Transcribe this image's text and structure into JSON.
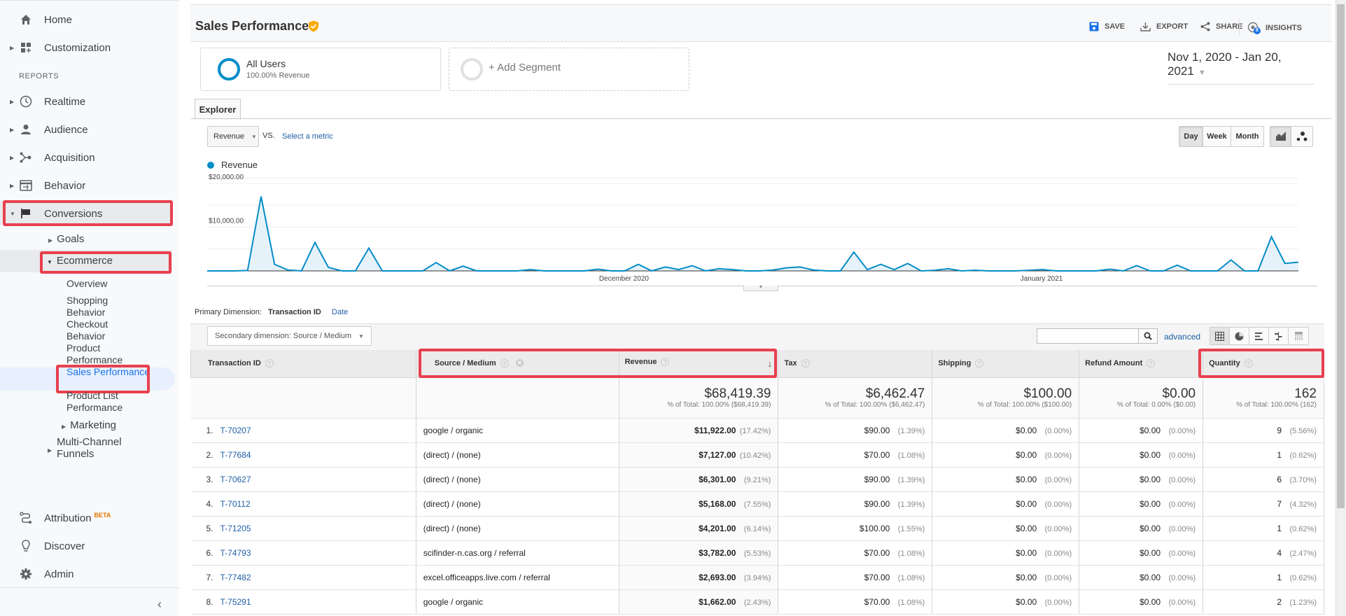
{
  "sidebar": {
    "home": "Home",
    "customization": "Customization",
    "reports_label": "REPORTS",
    "realtime": "Realtime",
    "audience": "Audience",
    "acquisition": "Acquisition",
    "behavior": "Behavior",
    "conversions": "Conversions",
    "goals": "Goals",
    "ecommerce": "Ecommerce",
    "ecommerce_items": [
      "Overview",
      "Shopping Behavior",
      "Checkout Behavior",
      "Product Performance",
      "Sales Performance",
      "Product List Performance"
    ],
    "marketing": "Marketing",
    "multi_channel_1": "Multi-Channel",
    "multi_channel_2": "Funnels",
    "attribution": "Attribution",
    "attribution_badge": "BETA",
    "discover": "Discover",
    "admin": "Admin",
    "collapse_icon": "‹"
  },
  "header": {
    "title": "Sales Performance",
    "save": "SAVE",
    "export": "EXPORT",
    "share": "SHARE",
    "insights": "INSIGHTS",
    "insights_count": "8"
  },
  "segments": {
    "all_users": "All Users",
    "all_users_sub": "100.00% Revenue",
    "add_segment": "+ Add Segment"
  },
  "date_range": "Nov 1, 2020 - Jan 20, 2021",
  "explorer": {
    "tab": "Explorer",
    "metric": "Revenue",
    "vs": "VS.",
    "select_metric": "Select a metric",
    "day": "Day",
    "week": "Week",
    "month": "Month"
  },
  "chart_data": {
    "type": "area",
    "series": [
      {
        "name": "Revenue",
        "color": "#058dc7",
        "values": [
          0,
          0,
          0,
          100,
          17000,
          1500,
          200,
          0,
          6500,
          800,
          0,
          0,
          5200,
          0,
          0,
          0,
          0,
          1900,
          0,
          1100,
          0,
          0,
          0,
          0,
          300,
          0,
          0,
          0,
          0,
          400,
          0,
          0,
          1500,
          0,
          900,
          300,
          1200,
          0,
          500,
          300,
          0,
          0,
          200,
          700,
          900,
          200,
          0,
          0,
          4300,
          300,
          1500,
          300,
          1700,
          0,
          150,
          500,
          0,
          150,
          0,
          0,
          0,
          150,
          300,
          0,
          0,
          0,
          0,
          400,
          0,
          1200,
          0,
          0,
          1300,
          0,
          0,
          0,
          2500,
          0,
          0,
          7800,
          1700,
          2000
        ]
      }
    ],
    "x_start": "2020-11-01",
    "x_end": "2021-01-20",
    "x_tick_labels": [
      "December 2020",
      "January 2021"
    ],
    "y_tick_labels": [
      "$10,000.00",
      "$20,000.00"
    ],
    "ylim": [
      0,
      20000
    ],
    "legend": "top-left",
    "grid": true
  },
  "table_controls": {
    "primary_dimension_label": "Primary Dimension:",
    "primary_dimension": "Transaction ID",
    "alt_dimension": "Date",
    "secondary_dimension": "Secondary dimension: Source / Medium",
    "search_placeholder": "",
    "advanced": "advanced"
  },
  "table": {
    "columns": [
      "Transaction ID",
      "Source / Medium",
      "Revenue",
      "Tax",
      "Shipping",
      "Refund Amount",
      "Quantity"
    ],
    "totals": {
      "revenue": "$68,419.39",
      "revenue_pct": "% of Total: 100.00% ($68,419.39)",
      "tax": "$6,462.47",
      "tax_pct": "% of Total: 100.00% ($6,462.47)",
      "shipping": "$100.00",
      "shipping_pct": "% of Total: 100.00% ($100.00)",
      "refund": "$0.00",
      "refund_pct": "% of Total: 0.00% ($0.00)",
      "quantity": "162",
      "quantity_pct": "% of Total: 100.00% (162)"
    },
    "rows": [
      {
        "n": "1.",
        "id": "T-70207",
        "source": "google / organic",
        "revenue": "$11,922.00",
        "revenue_pct": "(17.42%)",
        "tax": "$90.00",
        "tax_pct": "(1.39%)",
        "shipping": "$0.00",
        "shipping_pct": "(0.00%)",
        "refund": "$0.00",
        "refund_pct": "(0.00%)",
        "qty": "9",
        "qty_pct": "(5.56%)"
      },
      {
        "n": "2.",
        "id": "T-77684",
        "source": "(direct) / (none)",
        "revenue": "$7,127.00",
        "revenue_pct": "(10.42%)",
        "tax": "$70.00",
        "tax_pct": "(1.08%)",
        "shipping": "$0.00",
        "shipping_pct": "(0.00%)",
        "refund": "$0.00",
        "refund_pct": "(0.00%)",
        "qty": "1",
        "qty_pct": "(0.62%)"
      },
      {
        "n": "3.",
        "id": "T-70627",
        "source": "(direct) / (none)",
        "revenue": "$6,301.00",
        "revenue_pct": "(9.21%)",
        "tax": "$90.00",
        "tax_pct": "(1.39%)",
        "shipping": "$0.00",
        "shipping_pct": "(0.00%)",
        "refund": "$0.00",
        "refund_pct": "(0.00%)",
        "qty": "6",
        "qty_pct": "(3.70%)"
      },
      {
        "n": "4.",
        "id": "T-70112",
        "source": "(direct) / (none)",
        "revenue": "$5,168.00",
        "revenue_pct": "(7.55%)",
        "tax": "$90.00",
        "tax_pct": "(1.39%)",
        "shipping": "$0.00",
        "shipping_pct": "(0.00%)",
        "refund": "$0.00",
        "refund_pct": "(0.00%)",
        "qty": "7",
        "qty_pct": "(4.32%)"
      },
      {
        "n": "5.",
        "id": "T-71205",
        "source": "(direct) / (none)",
        "revenue": "$4,201.00",
        "revenue_pct": "(6.14%)",
        "tax": "$100.00",
        "tax_pct": "(1.55%)",
        "shipping": "$0.00",
        "shipping_pct": "(0.00%)",
        "refund": "$0.00",
        "refund_pct": "(0.00%)",
        "qty": "1",
        "qty_pct": "(0.62%)"
      },
      {
        "n": "6.",
        "id": "T-74793",
        "source": "scifinder-n.cas.org / referral",
        "revenue": "$3,782.00",
        "revenue_pct": "(5.53%)",
        "tax": "$70.00",
        "tax_pct": "(1.08%)",
        "shipping": "$0.00",
        "shipping_pct": "(0.00%)",
        "refund": "$0.00",
        "refund_pct": "(0.00%)",
        "qty": "4",
        "qty_pct": "(2.47%)"
      },
      {
        "n": "7.",
        "id": "T-77482",
        "source": "excel.officeapps.live.com / referral",
        "revenue": "$2,693.00",
        "revenue_pct": "(3.94%)",
        "tax": "$70.00",
        "tax_pct": "(1.08%)",
        "shipping": "$0.00",
        "shipping_pct": "(0.00%)",
        "refund": "$0.00",
        "refund_pct": "(0.00%)",
        "qty": "1",
        "qty_pct": "(0.62%)"
      },
      {
        "n": "8.",
        "id": "T-75291",
        "source": "google / organic",
        "revenue": "$1,662.00",
        "revenue_pct": "(2.43%)",
        "tax": "$70.00",
        "tax_pct": "(1.08%)",
        "shipping": "$0.00",
        "shipping_pct": "(0.00%)",
        "refund": "$0.00",
        "refund_pct": "(0.00%)",
        "qty": "2",
        "qty_pct": "(1.23%)"
      }
    ]
  },
  "colors": {
    "accent": "#058dc7",
    "link": "#1f5fa6",
    "highlight": "#e8404e",
    "badge": "#f9ab00"
  }
}
